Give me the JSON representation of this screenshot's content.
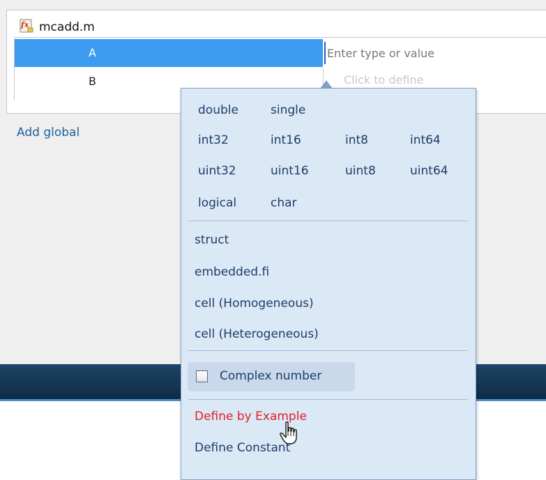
{
  "file": {
    "name": "mcadd.m",
    "icon": "function-file-icon"
  },
  "inputs": [
    {
      "name": "A",
      "selected": true
    },
    {
      "name": "B",
      "selected": false
    }
  ],
  "editor": {
    "placeholder": "Enter type or value",
    "ghost_hint": "Click to define"
  },
  "add_global_label": "Add global",
  "popup": {
    "numeric_rows": [
      [
        "double",
        "single"
      ],
      [
        "int32",
        "int16",
        "int8",
        "int64"
      ],
      [
        "uint32",
        "uint16",
        "uint8",
        "uint64"
      ],
      [
        "logical",
        "char"
      ]
    ],
    "other_types": [
      "struct",
      "embedded.fi",
      "cell (Homogeneous)",
      "cell (Heterogeneous)"
    ],
    "complex_label": "Complex number",
    "complex_checked": false,
    "define_by_example": "Define by Example",
    "define_constant": "Define Constant"
  },
  "colors": {
    "selection": "#3a9bf1",
    "popup_bg": "#dbe8f6",
    "popup_text": "#1f3c66",
    "highlight_text": "#e0202a",
    "link": "#1f5f9c"
  }
}
